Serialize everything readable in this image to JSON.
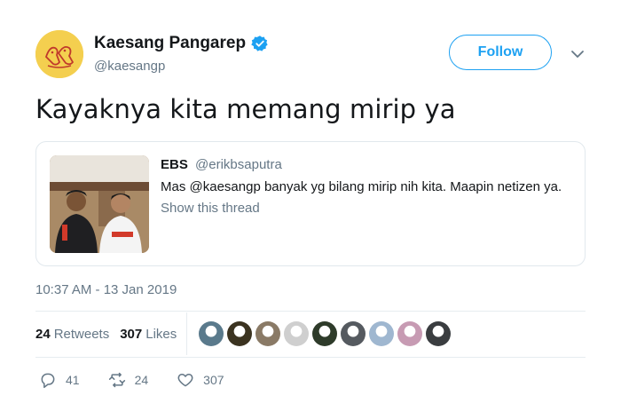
{
  "author": {
    "display_name": "Kaesang Pangarep",
    "handle": "@kaesangp",
    "verified": true,
    "avatar_icon": "dog-cartoon-avatar"
  },
  "follow_label": "Follow",
  "tweet_text": "Kayaknya kita memang mirip ya",
  "quoted_tweet": {
    "display_name": "EBS",
    "handle": "@erikbsaputra",
    "text": "Mas @kaesangp banyak yg bilang mirip nih kita. Maapin netizen ya.",
    "thread_link": "Show this thread"
  },
  "timestamp": "10:37 AM - 13 Jan 2019",
  "stats": {
    "retweets_count": "24",
    "retweets_label": "Retweets",
    "likes_count": "307",
    "likes_label": "Likes"
  },
  "liker_avatars": [
    "#5a7a8c",
    "#3b3320",
    "#8a7a66",
    "#cfcfcf",
    "#2e3b2a",
    "#555a60",
    "#9fb7d0",
    "#c79bb3",
    "#3a3d40"
  ],
  "actions": {
    "reply_count": "41",
    "retweet_count": "24",
    "like_count": "307"
  },
  "colors": {
    "accent": "#1da1f2",
    "muted": "#657786",
    "text": "#14171a",
    "border": "#e1e8ed"
  }
}
